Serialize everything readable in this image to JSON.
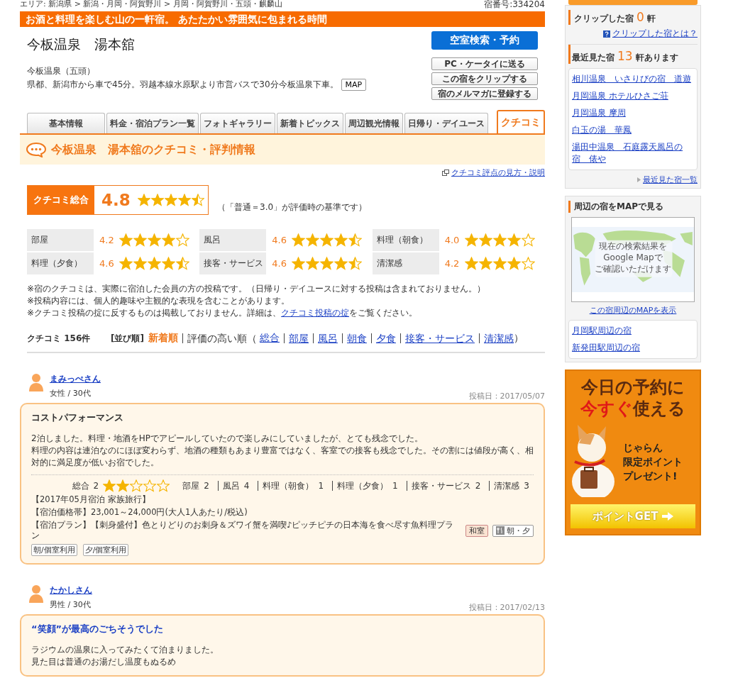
{
  "breadcrumb": "エリア: 新潟県 > 新潟・月岡・阿賀野川 > 月岡・阿賀野川・五頭・麒麟山",
  "inn_number": "宿番号:334204",
  "catchphrase": "お酒と料理を楽しむ山の一軒宿。 あたたかい雰囲気に包まれる時間",
  "hotel": {
    "name": "今板温泉　湯本舘",
    "area": "今板温泉（五頭）",
    "access": "県都、新潟市から車で45分。羽越本線水原駅より市営バスで30分今板温泉下車。",
    "map_button": "MAP"
  },
  "primary_button": "空室検索・予約",
  "action_buttons": [
    "PC・ケータイに送る",
    "この宿をクリップする",
    "宿のメルマガに登録する"
  ],
  "tabs": [
    {
      "label": "基本情報",
      "selected": false
    },
    {
      "label": "料金・宿泊プラン一覧",
      "selected": false
    },
    {
      "label": "フォトギャラリー",
      "selected": false
    },
    {
      "label": "新着トピックス",
      "selected": false
    },
    {
      "label": "周辺観光情報",
      "selected": false
    },
    {
      "label": "日帰り・デイユース",
      "selected": false
    },
    {
      "label": "クチコミ",
      "selected": true
    }
  ],
  "section_title": "今板温泉　湯本舘のクチコミ・評判情報",
  "help_link": "クチコミ評点の見方・説明",
  "overall": {
    "label": "クチコミ総合",
    "score": "4.8",
    "stars": 4.5,
    "note": "（「普通＝3.0」が評価時の基準です）"
  },
  "ratings": [
    {
      "label": "部屋",
      "score": "4.2",
      "stars": 4
    },
    {
      "label": "風呂",
      "score": "4.6",
      "stars": 4.5
    },
    {
      "label": "料理（朝食）",
      "score": "4.0",
      "stars": 4
    },
    {
      "label": "料理（夕食）",
      "score": "4.6",
      "stars": 4.5
    },
    {
      "label": "接客・サービス",
      "score": "4.6",
      "stars": 4.5
    },
    {
      "label": "清潔感",
      "score": "4.2",
      "stars": 4
    }
  ],
  "notes": [
    "※宿のクチコミは、実際に宿泊した会員の方の投稿です。（日帰り・デイユースに対する投稿は含まれておりません。）",
    "※投稿内容には、個人的趣味や主観的な表現を含むことがあります。"
  ],
  "rules_note": {
    "before": "※クチコミ投稿の掟に反するものは掲載しておりません。詳細は、",
    "link": "クチコミ投稿の掟",
    "after": "をご覧ください。"
  },
  "sort": {
    "count": "クチコミ 156件",
    "label": "[並び順]",
    "options": [
      {
        "label": "新着順",
        "selected": true
      }
    ],
    "rating_label": "評価の高い順（",
    "rating_links": [
      "総合",
      "部屋",
      "風呂",
      "朝食",
      "夕食",
      "接客・サービス",
      "清潔感"
    ],
    "close": "）"
  },
  "reviews": [
    {
      "name": "まみっぺさん",
      "profile": "女性 / 30代",
      "date": "投稿日：2017/05/07",
      "title": "コストパフォーマンス",
      "highlighted": false,
      "body": [
        "2泊しました。料理・地酒をHPでアピールしていたので楽しみにしていましたが、とても残念でした。",
        "料理の内容は連泊なのにほぼ変わらず、地酒の種類もあまり豊富ではなく、客室での接客も残念でした。その割には値段が高く、相対的に満足度が低いお宿でした。"
      ],
      "overall": {
        "label": "総合",
        "value": "2",
        "stars": 2
      },
      "scores": [
        {
          "label": "部屋",
          "value": "2"
        },
        {
          "label": "風呂",
          "value": "4"
        },
        {
          "label": "料理（朝食）",
          "value": "1"
        },
        {
          "label": "料理（夕食）",
          "value": "1"
        },
        {
          "label": "接客・サービス",
          "value": "2"
        },
        {
          "label": "清潔感",
          "value": "3"
        }
      ],
      "stay": "【2017年05月宿泊 家族旅行】",
      "price": "【宿泊価格帯】23,001～24,000円(大人1人あたり/税込)",
      "plan": "【宿泊プラン】【刺身盛付】色とりどりのお刺身＆ズワイ蟹を満喫♪ピッチピチの日本海を食べ尽す魚料理プラン",
      "plan_tags": [
        {
          "label": "和室",
          "kind": "room"
        },
        {
          "label": "朝・夕",
          "kind": "meal"
        }
      ],
      "usage_tags": [
        "朝/個室利用",
        "夕/個室利用"
      ]
    },
    {
      "name": "たかしさん",
      "profile": "男性 / 30代",
      "date": "投稿日：2017/02/13",
      "title": "“笑顔”が最高のごちそうでした",
      "highlighted": true,
      "body": [
        "ラジウムの温泉に入ってみたくて泊まりました。",
        "見た目は普通のお湯だし温度もぬるめ"
      ]
    }
  ],
  "sidebar": {
    "clip": {
      "label": "クリップした宿",
      "count": "0",
      "unit": "軒",
      "help": "クリップした宿とは？"
    },
    "recent": {
      "label": "最近見た宿",
      "count": "13",
      "unit": "軒あります",
      "items": [
        "相川温泉　いさりびの宿　道遊",
        "月岡温泉 ホテルひさご荘",
        "月岡温泉 摩周",
        "白玉の湯　華鳳",
        "湯田中温泉　石庭露天風呂の宿　俵や"
      ],
      "more": "最近見た宿一覧"
    },
    "map": {
      "title": "周辺の宿をMAPで見る",
      "overlay": [
        "現在の検索結果を",
        "Google Mapで",
        "ご確認いただけます"
      ],
      "link": "この宿周辺のMAPを表示",
      "nearby": [
        "月岡駅周辺の宿",
        "新発田駅周辺の宿"
      ]
    },
    "ad": {
      "headline_1": "今日の予約に",
      "headline_2a": "今すぐ",
      "headline_2b": "使える",
      "body": [
        "じゃらん",
        "限定ポイント",
        "プレゼント!"
      ],
      "button": "ポイントGET"
    }
  }
}
